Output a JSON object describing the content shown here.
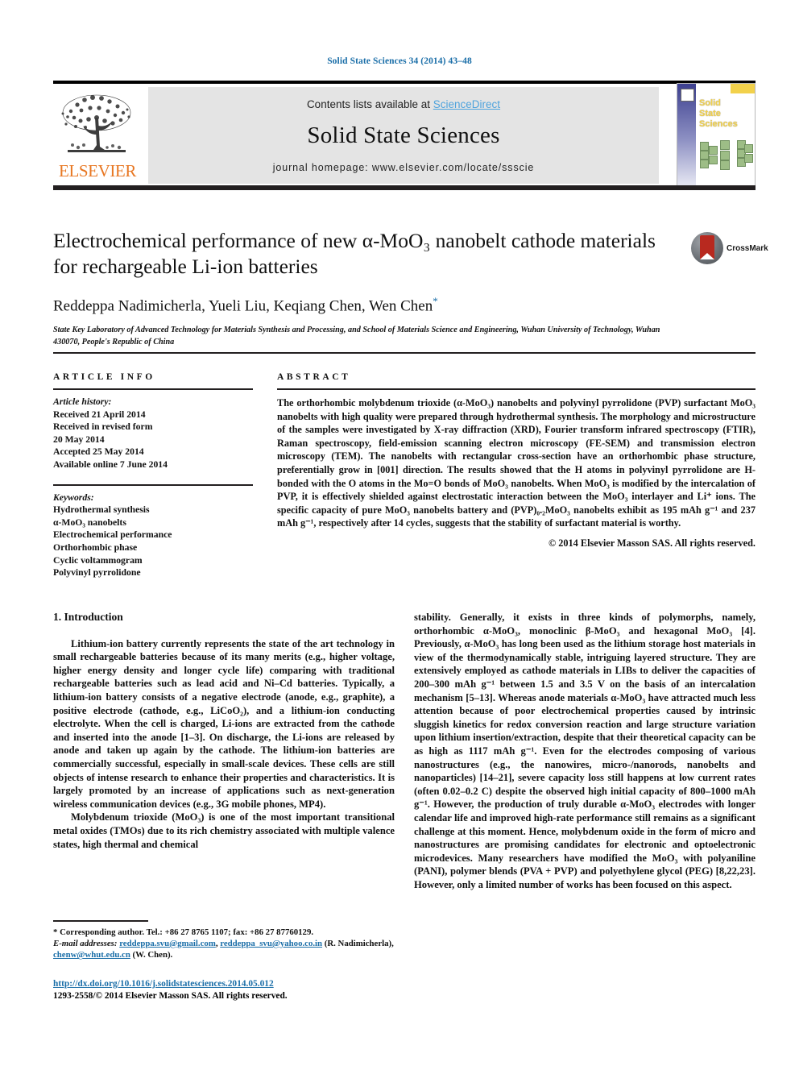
{
  "running_head": "Solid State Sciences 34 (2014) 43–48",
  "masthead": {
    "contents_prefix": "Contents lists available at ",
    "sciencedirect": "ScienceDirect",
    "journal_title": "Solid State Sciences",
    "homepage": "journal homepage: www.elsevier.com/locate/ssscie",
    "publisher_logo_text": "ELSEVIER",
    "cover_title_lines": [
      "Solid",
      "State",
      "Sciences"
    ]
  },
  "article": {
    "title": "Electrochemical performance of new α-MoO₃ nanobelt cathode materials for rechargeable Li-ion batteries",
    "authors": "Reddeppa Nadimicherla, Yueli Liu, Keqiang Chen, Wen Chen",
    "corresponding_marker": "*",
    "affiliation": "State Key Laboratory of Advanced Technology for Materials Synthesis and Processing, and School of Materials Science and Engineering, Wuhan University of Technology, Wuhan 430070, People's Republic of China",
    "crossmark_label": "CrossMark"
  },
  "article_info": {
    "heading": "ARTICLE INFO",
    "history_label": "Article history:",
    "history": [
      "Received 21 April 2014",
      "Received in revised form",
      "20 May 2014",
      "Accepted 25 May 2014",
      "Available online 7 June 2014"
    ],
    "keywords_label": "Keywords:",
    "keywords": [
      "Hydrothermal synthesis",
      "α-MoO₃ nanobelts",
      "Electrochemical performance",
      "Orthorhombic phase",
      "Cyclic voltammogram",
      "Polyvinyl pyrrolidone"
    ]
  },
  "abstract": {
    "heading": "ABSTRACT",
    "text": "The orthorhombic molybdenum trioxide (α-MoO₃) nanobelts and polyvinyl pyrrolidone (PVP) surfactant MoO₃ nanobelts with high quality were prepared through hydrothermal synthesis. The morphology and microstructure of the samples were investigated by X-ray diffraction (XRD), Fourier transform infrared spectroscopy (FTIR), Raman spectroscopy, field-emission scanning electron microscopy (FE-SEM) and transmission electron microscopy (TEM). The nanobelts with rectangular cross-section have an orthorhombic phase structure, preferentially grow in [001] direction. The results showed that the H atoms in polyvinyl pyrrolidone are H-bonded with the O atoms in the Mo=O bonds of MoO₃ nanobelts. When MoO₃ is modified by the intercalation of PVP, it is effectively shielded against electrostatic interaction between the MoO₃ interlayer and Li⁺ ions. The specific capacity of pure MoO₃ nanobelts battery and (PVP)₀.₂MoO₃ nanobelts exhibit as 195 mAh g⁻¹ and 237 mAh g⁻¹, respectively after 14 cycles, suggests that the stability of surfactant material is worthy.",
    "copyright": "© 2014 Elsevier Masson SAS. All rights reserved."
  },
  "introduction": {
    "heading": "1. Introduction",
    "left_paragraphs": [
      "Lithium-ion battery currently represents the state of the art technology in small rechargeable batteries because of its many merits (e.g., higher voltage, higher energy density and longer cycle life) comparing with traditional rechargeable batteries such as lead acid and Ni–Cd batteries. Typically, a lithium-ion battery consists of a negative electrode (anode, e.g., graphite), a positive electrode (cathode, e.g., LiCoO₂), and a lithium-ion conducting electrolyte. When the cell is charged, Li-ions are extracted from the cathode and inserted into the anode [1–3]. On discharge, the Li-ions are released by anode and taken up again by the cathode. The lithium-ion batteries are commercially successful, especially in small-scale devices. These cells are still objects of intense research to enhance their properties and characteristics. It is largely promoted by an increase of applications such as next-generation wireless communication devices (e.g., 3G mobile phones, MP4).",
      "Molybdenum trioxide (MoO₃) is one of the most important transitional metal oxides (TMOs) due to its rich chemistry associated with multiple valence states, high thermal and chemical"
    ],
    "right_paragraphs": [
      "stability. Generally, it exists in three kinds of polymorphs, namely, orthorhombic α-MoO₃, monoclinic β-MoO₃ and hexagonal MoO₃ [4]. Previously, α-MoO₃ has long been used as the lithium storage host materials in view of the thermodynamically stable, intriguing layered structure. They are extensively employed as cathode materials in LIBs to deliver the capacities of 200–300 mAh g⁻¹ between 1.5 and 3.5 V on the basis of an intercalation mechanism [5–13]. Whereas anode materials α-MoO₃ have attracted much less attention because of poor electrochemical properties caused by intrinsic sluggish kinetics for redox conversion reaction and large structure variation upon lithium insertion/extraction, despite that their theoretical capacity can be as high as 1117 mAh g⁻¹. Even for the electrodes composing of various nanostructures (e.g., the nanowires, micro-/nanorods, nanobelts and nanoparticles) [14–21], severe capacity loss still happens at low current rates (often 0.02–0.2 C) despite the observed high initial capacity of 800–1000 mAh g⁻¹. However, the production of truly durable α-MoO₃ electrodes with longer calendar life and improved high-rate performance still remains as a significant challenge at this moment. Hence, molybdenum oxide in the form of micro and nanostructures are promising candidates for electronic and optoelectronic microdevices. Many researchers have modified the MoO₃ with polyaniline (PANI), polymer blends (PVA + PVP) and polyethylene glycol (PEG) [8,22,23]. However, only a limited number of works has been focused on this aspect."
    ]
  },
  "footnote": {
    "star": "*",
    "corresponding": "Corresponding author. Tel.: +86 27 8765 1107; fax: +86 27 87760129.",
    "email_label": "E-mail addresses:",
    "email1": "reddeppa.svu@gmail.com",
    "email2": "reddeppa_svu@yahoo.co.in",
    "email1_owner": "(R. Nadimicherla),",
    "email3": "chenw@whut.edu.cn",
    "email3_owner": "(W. Chen)."
  },
  "doi": {
    "url": "http://dx.doi.org/10.1016/j.solidstatesciences.2014.05.012",
    "issn_line": "1293-2558/© 2014 Elsevier Masson SAS. All rights reserved."
  },
  "colors": {
    "link": "#1a6ea8",
    "sd_link": "#4ea3dd",
    "elsevier_orange": "#e87722",
    "band_gray": "#e4e4e4"
  }
}
